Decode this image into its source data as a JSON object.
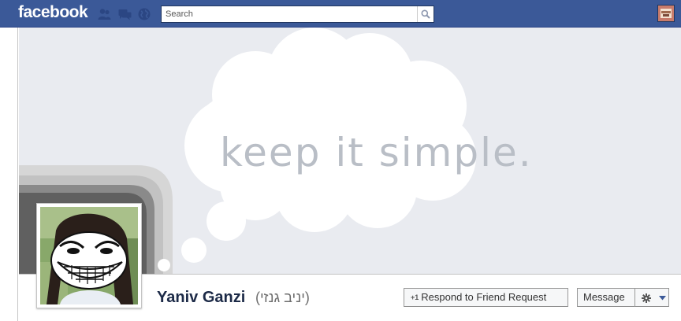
{
  "topbar": {
    "logo": "facebook",
    "search": {
      "placeholder": "Search",
      "value": ""
    },
    "icons": [
      "friend-requests-icon",
      "messages-icon",
      "notifications-globe-icon",
      "search-icon"
    ]
  },
  "cover": {
    "text": "keep it simple."
  },
  "profile": {
    "name": "Yaniv Ganzi",
    "alternate_name": "(יניב גנזי)"
  },
  "actions": {
    "respond_label": "Respond to Friend Request",
    "respond_prefix": "+1",
    "message_label": "Message",
    "settings_icon": "gear-icon"
  },
  "colors": {
    "brand_blue": "#3b5998",
    "cover_background": "#e9ebf0",
    "name_color": "#1c2a47"
  }
}
